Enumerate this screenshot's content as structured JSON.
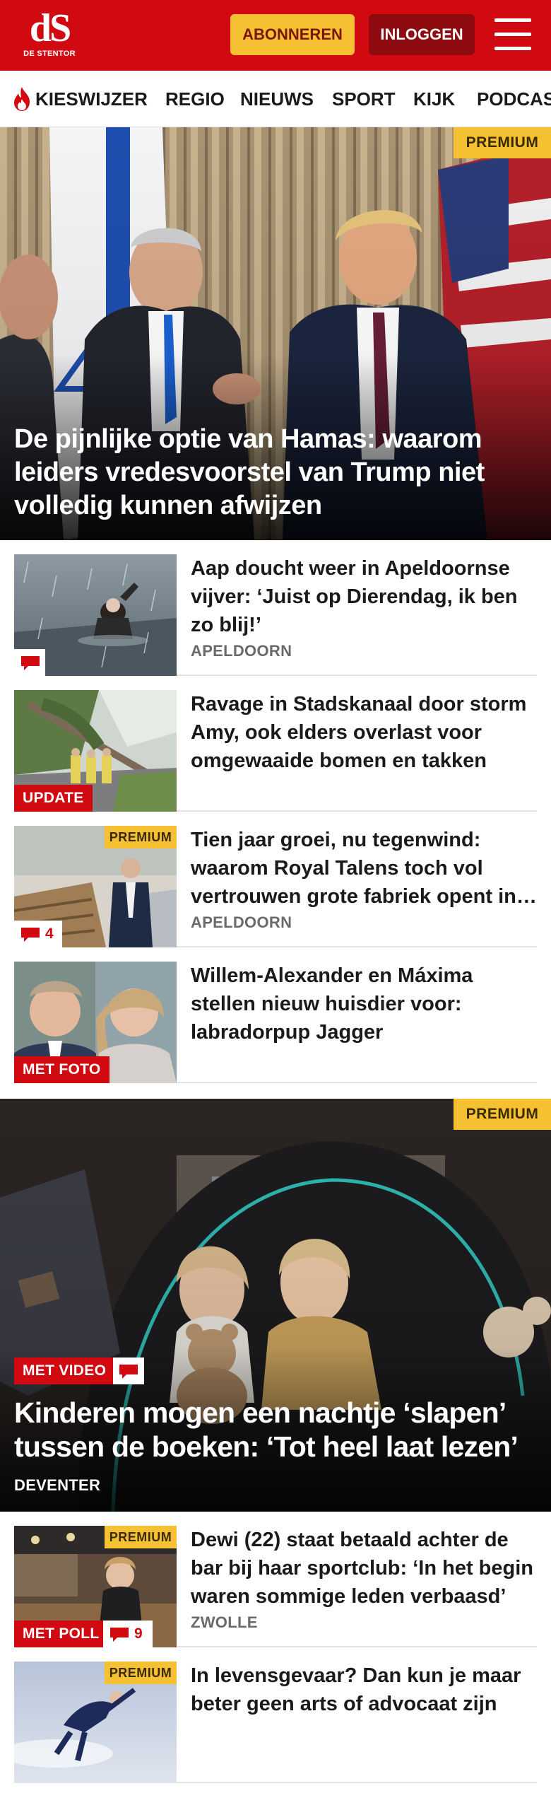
{
  "header": {
    "logo_mark": "dS",
    "logo_sub": "DE STENTOR",
    "subscribe_label": "ABONNEREN",
    "login_label": "INLOGGEN",
    "brand_color": "#d10a11",
    "accent_color": "#f6c033"
  },
  "nav": {
    "items": [
      "KIESWIJZER",
      "REGIO",
      "NIEUWS",
      "SPORT",
      "KIJK",
      "PODCAST"
    ]
  },
  "hero": {
    "badge": "PREMIUM",
    "title": "De pijnlijke optie van Hamas: waarom leiders vredesvoorstel van Trump niet volledig kunnen afwijzen"
  },
  "articles": [
    {
      "title": "Aap doucht weer in Apeldoornse vijver: ‘Juist op Dierendag, ik ben zo blij!’",
      "location": "APELDOORN",
      "comment_count": ""
    },
    {
      "title": "Ravage in Stadskanaal door storm Amy, ook elders overlast voor omgewaaide bomen en takken",
      "label": "UPDATE"
    },
    {
      "badge": "PREMIUM",
      "title": "Tien jaar groei, nu tegenwind: waarom Royal Talens toch vol vertrouwen grote fabriek opent in Apeldoorn",
      "location": "APELDOORN",
      "comment_count": "4"
    },
    {
      "title": "Willem-Alexander en Máxima stellen nieuw huisdier voor: labradorpup Jagger",
      "label": "MET FOTO"
    }
  ],
  "feature": {
    "badge": "PREMIUM",
    "label": "MET VIDEO",
    "title": "Kinderen mogen een nachtje ‘slapen’ tussen de boeken: ‘Tot heel laat lezen’",
    "location": "DEVENTER"
  },
  "articles_bottom": [
    {
      "badge": "PREMIUM",
      "title": "Dewi (22) staat betaald achter de bar bij haar sportclub: ‘In het begin waren sommige leden verbaasd’",
      "location": "ZWOLLE",
      "label": "MET POLL",
      "comment_count": "9"
    },
    {
      "badge": "PREMIUM",
      "title": "In levensgevaar? Dan kun je maar beter geen arts of advocaat zijn"
    }
  ]
}
